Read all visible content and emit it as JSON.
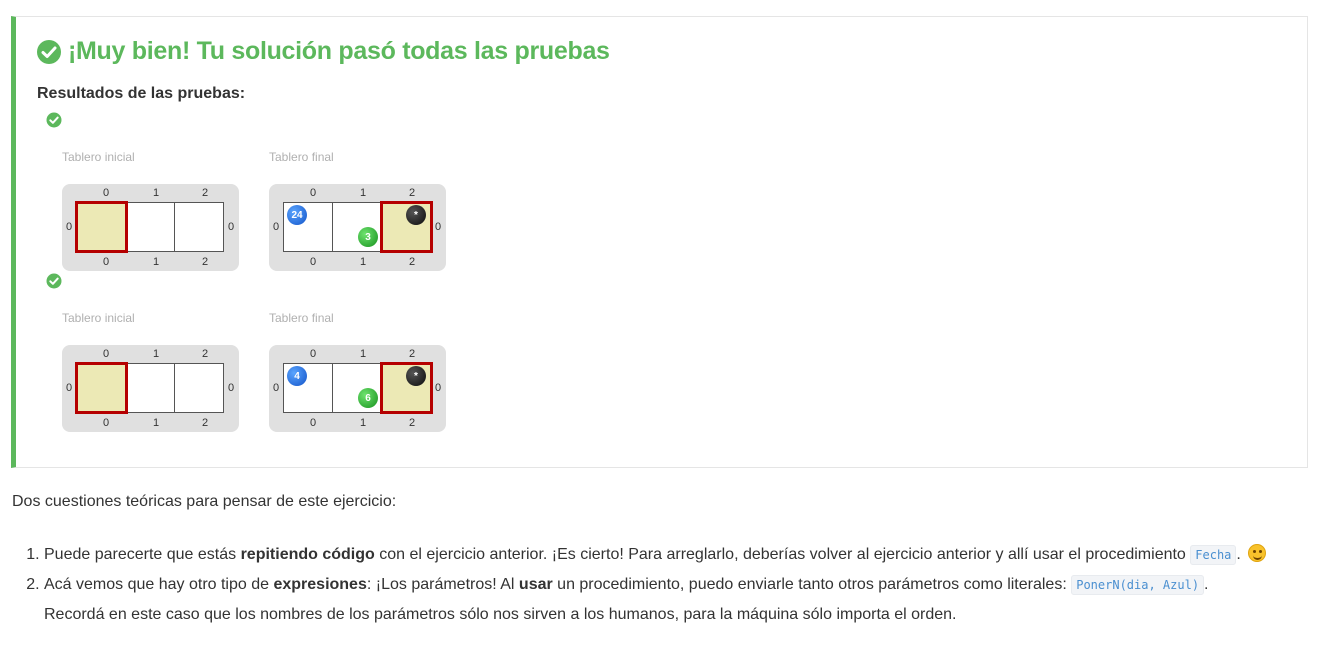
{
  "result": {
    "title": "¡Muy bien! Tu solución pasó todas las pruebas",
    "subtitle": "Resultados de las pruebas:",
    "tests": [
      {
        "initial_label": "Tablero inicial",
        "final_label": "Tablero final",
        "initial_board": {
          "columns": [
            "0",
            "1",
            "2"
          ],
          "rows": [
            "0"
          ],
          "head_column": 0,
          "balls": []
        },
        "final_board": {
          "columns": [
            "0",
            "1",
            "2"
          ],
          "rows": [
            "0"
          ],
          "head_column": 2,
          "balls": [
            {
              "column": 0,
              "color": "blue",
              "count": "24"
            },
            {
              "column": 1,
              "color": "green",
              "count": "3"
            },
            {
              "column": 2,
              "color": "black",
              "count": "*"
            }
          ]
        }
      },
      {
        "initial_label": "Tablero inicial",
        "final_label": "Tablero final",
        "initial_board": {
          "columns": [
            "0",
            "1",
            "2"
          ],
          "rows": [
            "0"
          ],
          "head_column": 0,
          "balls": []
        },
        "final_board": {
          "columns": [
            "0",
            "1",
            "2"
          ],
          "rows": [
            "0"
          ],
          "head_column": 2,
          "balls": [
            {
              "column": 0,
              "color": "blue",
              "count": "4"
            },
            {
              "column": 1,
              "color": "green",
              "count": "6"
            },
            {
              "column": 2,
              "color": "black",
              "count": "*"
            }
          ]
        }
      }
    ],
    "success_color": "#5cb85c"
  },
  "content": {
    "intro": "Dos cuestiones teóricas para pensar de este ejercicio:",
    "q1": {
      "before": "Puede parecerte que estás ",
      "bold": "repitiendo código",
      "middle": " con el ejercicio anterior. ¡Es cierto! Para arreglarlo, deberías volver al ejercicio anterior y allí usar el procedimiento ",
      "code": "Fecha",
      "after": ". ",
      "emoji": "smiling-face-icon"
    },
    "q2": {
      "part1": "Acá vemos que hay otro tipo de ",
      "bold1": "expresiones",
      "part2": ": ¡Los parámetros! Al ",
      "bold2": "usar",
      "part3": " un procedimiento, puedo enviarle tanto otros parámetros como literales: ",
      "code": "PonerN(dia, Azul)",
      "part4": ".",
      "line2": "Recordá en este caso que los nombres de los parámetros sólo nos sirven a los humanos, para la máquina sólo importa el orden."
    }
  }
}
